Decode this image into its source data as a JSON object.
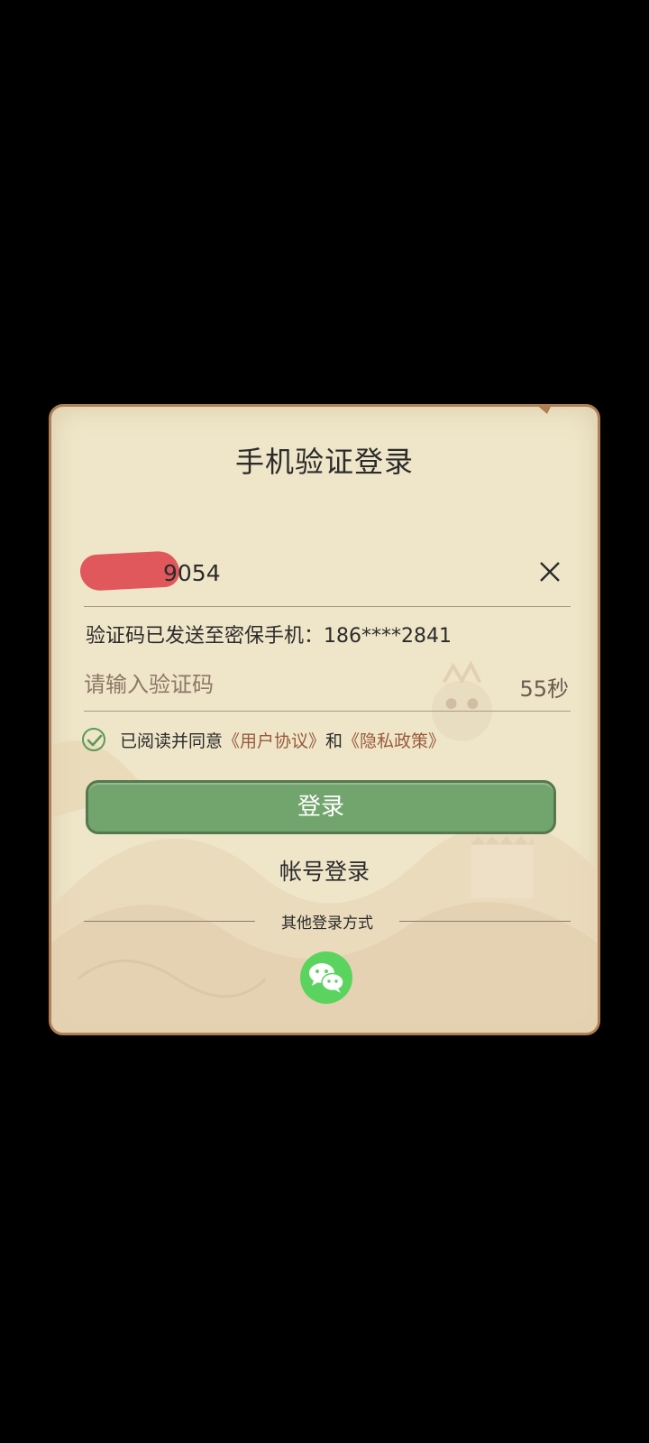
{
  "dialog": {
    "title": "手机验证登录",
    "phone": {
      "value_suffix": "9054",
      "clear_icon": "close-icon"
    },
    "sent_notice": "验证码已发送至密保手机：186****2841",
    "code": {
      "placeholder": "请输入验证码",
      "countdown": "55秒"
    },
    "agreement": {
      "prefix": "已阅读并同意",
      "user_agreement": "《用户协议》",
      "conjunction": "和",
      "privacy_policy": "《隐私政策》",
      "checked": true
    },
    "login_button": "登录",
    "account_login": "帐号登录",
    "other_methods": "其他登录方式",
    "wechat_icon": "wechat-icon"
  },
  "colors": {
    "panel": "#efe6c9",
    "border": "#b07e55",
    "button": "#72a56d",
    "link": "#9a5a3c",
    "wechat": "#5bd35f"
  }
}
